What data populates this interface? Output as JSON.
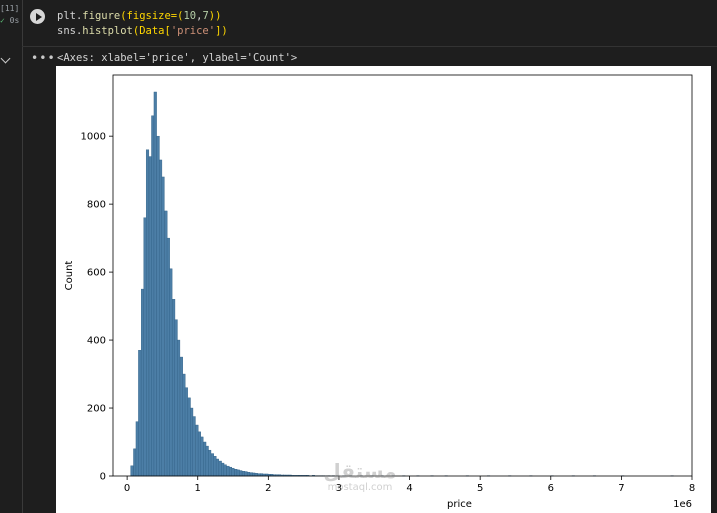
{
  "cell": {
    "execution_count": "[11]",
    "status_icon": "checkmark-icon",
    "status_time": "0s",
    "code_line1": {
      "a": "plt.",
      "fn": "figure",
      "b": "(figsize=(",
      "n1": "10",
      "c": ",",
      "n2": "7",
      "d": "))"
    },
    "code_line2": {
      "a": "sns.",
      "fn": "histplot",
      "b": "(Data[",
      "s": "'price'",
      "d": "])"
    },
    "output_text": "<Axes: xlabel='price', ylabel='Count'>"
  },
  "colors": {
    "bar_fill": "#4c7ea6",
    "bar_edge": "#2f5f85",
    "background": "#1e1e1e"
  },
  "chart_data": {
    "type": "bar",
    "xlabel": "price",
    "ylabel": "Count",
    "offset_label": "1e6",
    "xlim": [
      -0.2,
      8.0
    ],
    "ylim": [
      0,
      1180
    ],
    "xticks": [
      0,
      1,
      2,
      3,
      4,
      5,
      6,
      7,
      8
    ],
    "yticks": [
      0,
      200,
      400,
      600,
      800,
      1000
    ],
    "bin_width": 0.0375,
    "bins": [
      [
        0.05,
        30
      ],
      [
        0.09,
        80
      ],
      [
        0.125,
        160
      ],
      [
        0.16,
        370
      ],
      [
        0.2,
        550
      ],
      [
        0.235,
        760
      ],
      [
        0.27,
        960
      ],
      [
        0.31,
        940
      ],
      [
        0.345,
        1060
      ],
      [
        0.38,
        1130
      ],
      [
        0.42,
        1000
      ],
      [
        0.455,
        930
      ],
      [
        0.49,
        880
      ],
      [
        0.53,
        780
      ],
      [
        0.565,
        700
      ],
      [
        0.6,
        610
      ],
      [
        0.64,
        520
      ],
      [
        0.675,
        460
      ],
      [
        0.71,
        400
      ],
      [
        0.75,
        350
      ],
      [
        0.785,
        300
      ],
      [
        0.82,
        260
      ],
      [
        0.86,
        230
      ],
      [
        0.895,
        200
      ],
      [
        0.93,
        175
      ],
      [
        0.97,
        150
      ],
      [
        1.005,
        130
      ],
      [
        1.04,
        115
      ],
      [
        1.08,
        100
      ],
      [
        1.115,
        88
      ],
      [
        1.15,
        76
      ],
      [
        1.19,
        66
      ],
      [
        1.225,
        58
      ],
      [
        1.26,
        50
      ],
      [
        1.3,
        44
      ],
      [
        1.335,
        38
      ],
      [
        1.37,
        33
      ],
      [
        1.41,
        29
      ],
      [
        1.445,
        26
      ],
      [
        1.48,
        23
      ],
      [
        1.52,
        20
      ],
      [
        1.555,
        18
      ],
      [
        1.59,
        16
      ],
      [
        1.63,
        14
      ],
      [
        1.665,
        13
      ],
      [
        1.7,
        11
      ],
      [
        1.74,
        10
      ],
      [
        1.775,
        9
      ],
      [
        1.81,
        8
      ],
      [
        1.85,
        7
      ],
      [
        1.885,
        7
      ],
      [
        1.92,
        6
      ],
      [
        1.96,
        6
      ],
      [
        1.995,
        5
      ],
      [
        2.03,
        5
      ],
      [
        2.07,
        4
      ],
      [
        2.1,
        4
      ],
      [
        2.14,
        4
      ],
      [
        2.18,
        3
      ],
      [
        2.21,
        3
      ],
      [
        2.25,
        3
      ],
      [
        2.29,
        3
      ],
      [
        2.32,
        2
      ],
      [
        2.36,
        2
      ],
      [
        2.4,
        2
      ],
      [
        2.43,
        2
      ],
      [
        2.47,
        2
      ],
      [
        2.51,
        2
      ],
      [
        2.54,
        2
      ],
      [
        2.58,
        1
      ],
      [
        2.62,
        2
      ],
      [
        2.65,
        1
      ],
      [
        2.69,
        1
      ],
      [
        2.73,
        1
      ],
      [
        2.76,
        1
      ],
      [
        2.8,
        1
      ],
      [
        2.84,
        1
      ],
      [
        2.9,
        1
      ],
      [
        2.96,
        1
      ],
      [
        3.05,
        1
      ],
      [
        3.15,
        1
      ],
      [
        3.3,
        1
      ],
      [
        3.45,
        1
      ],
      [
        3.6,
        1
      ],
      [
        3.75,
        1
      ],
      [
        3.9,
        1
      ],
      [
        4.1,
        1
      ],
      [
        4.3,
        1
      ],
      [
        4.5,
        1
      ],
      [
        4.8,
        1
      ],
      [
        5.1,
        1
      ],
      [
        5.4,
        1
      ],
      [
        5.7,
        1
      ],
      [
        6.0,
        1
      ],
      [
        6.3,
        1
      ],
      [
        6.6,
        1
      ],
      [
        7.0,
        1
      ],
      [
        7.7,
        1
      ]
    ]
  },
  "watermark": {
    "arabic": "مستقل",
    "latin": "mostaql.com"
  }
}
